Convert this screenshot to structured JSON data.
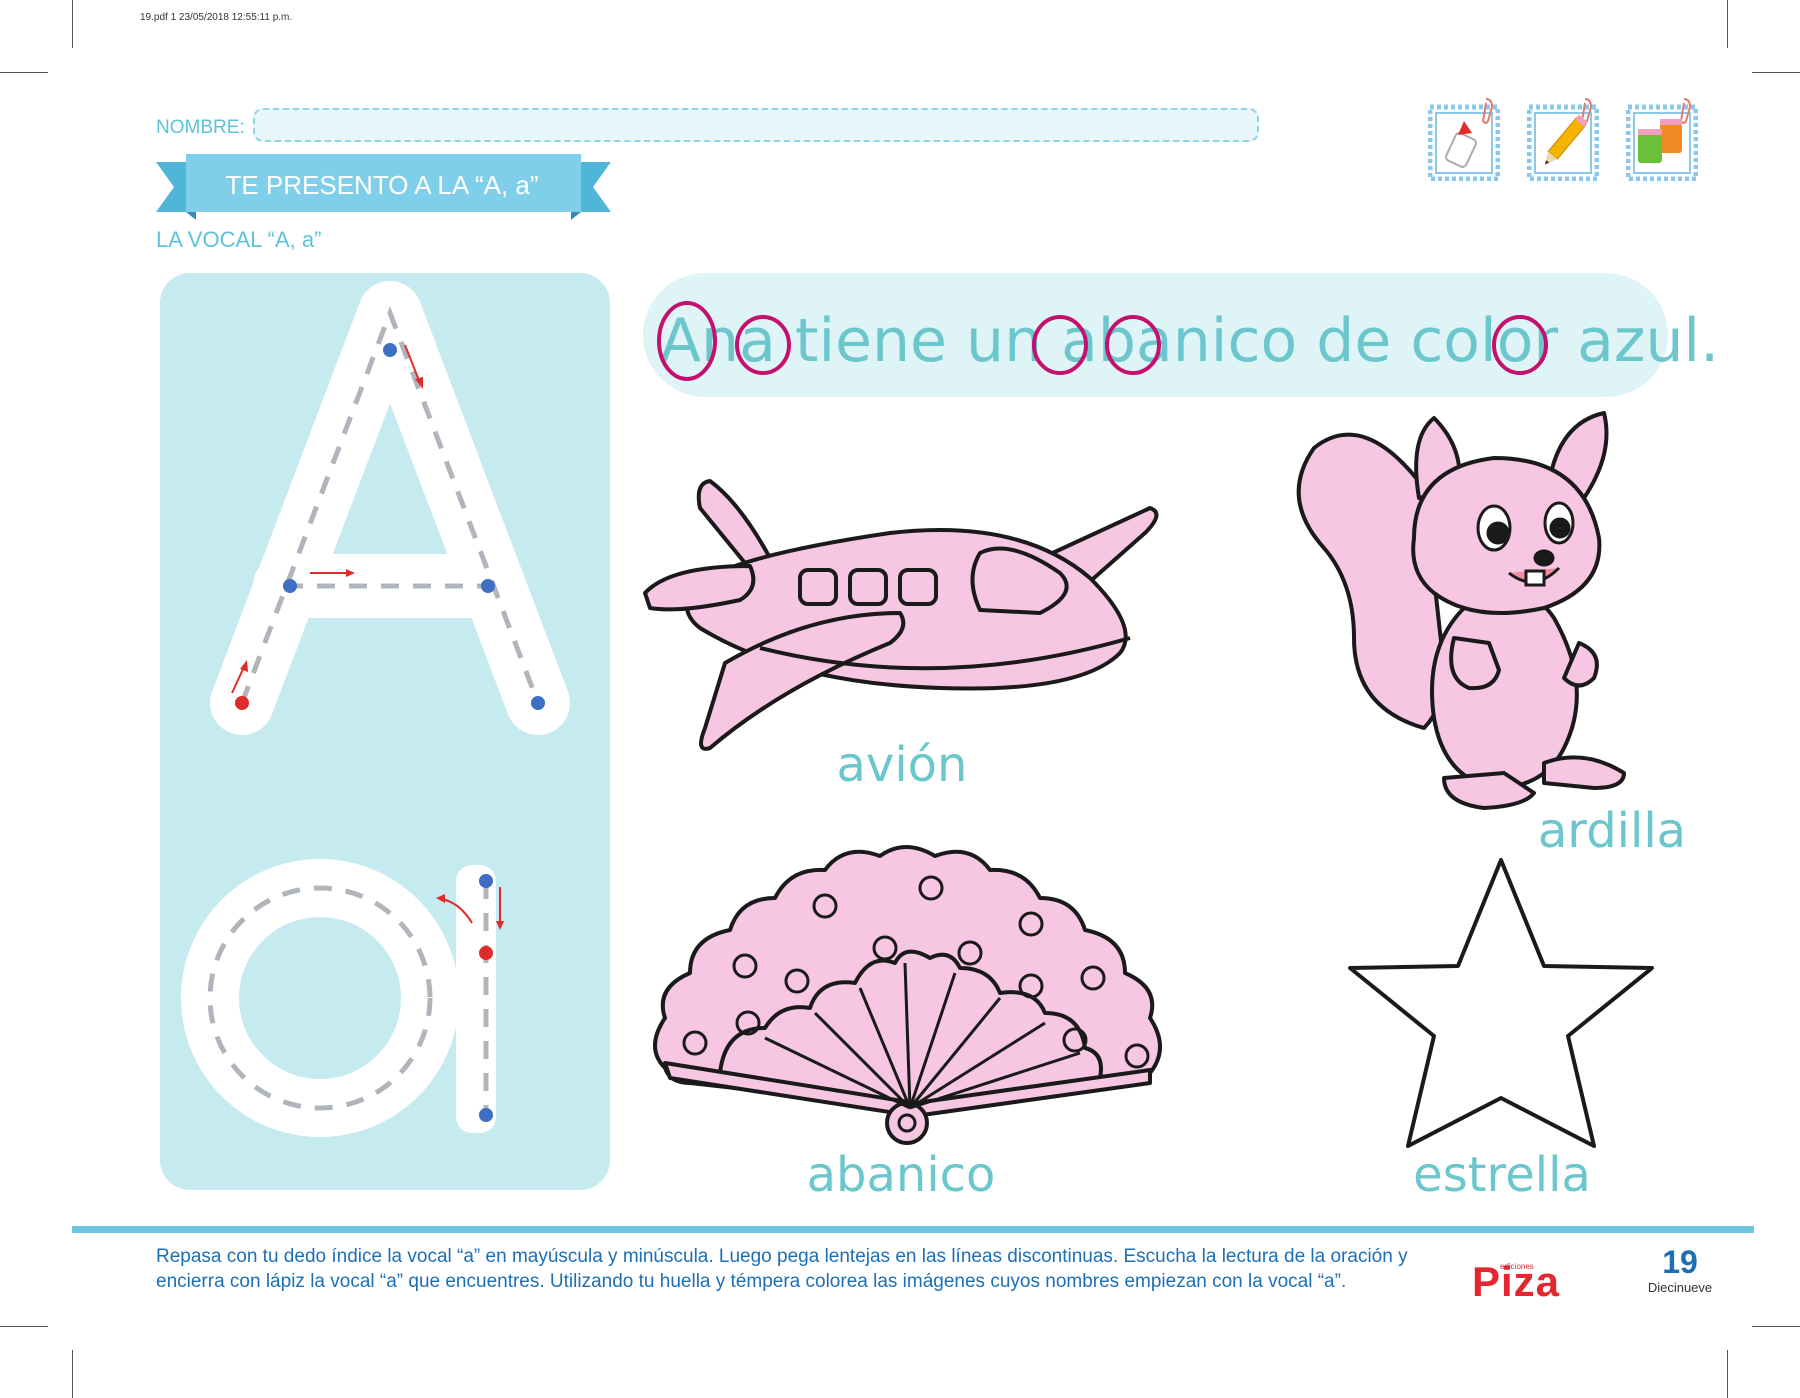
{
  "print_info": "19.pdf   1   23/05/2018   12:55:11 p.m.",
  "header": {
    "name_label": "NOMBRE:",
    "title": "TE PRESENTO A LA “A, a”",
    "subtitle": "LA VOCAL “A, a”"
  },
  "tools": [
    {
      "icon": "glue-icon"
    },
    {
      "icon": "pencil-icon"
    },
    {
      "icon": "paint-icon"
    }
  ],
  "sentence": "Ana tiene un abanico de color azul.",
  "pictures": {
    "plane_label": "avión",
    "squirrel_label": "ardilla",
    "fan_label": "abanico",
    "star_label": "estrella"
  },
  "footer": {
    "instructions": "Repasa con tu dedo índice la vocal “a” en mayúscula y minúscula. Luego pega lentejas en las líneas discontinuas. Escucha la lectura de la oración y encierra con lápiz la vocal “a” que encuentres. Utilizando tu huella y témpera colorea las imágenes cuyos nombres empiezan con la vocal “a”.",
    "brand": "Piza",
    "brand_sub": "ediciones",
    "page_number": "19",
    "page_word": "Diecinueve"
  },
  "colors": {
    "accent": "#6cc7cd",
    "banner": "#7fcfea",
    "pink_fill": "#f7c6e3",
    "circle": "#c4106e",
    "arrow": "#e02b2b",
    "dot": "#3f6fc4"
  }
}
